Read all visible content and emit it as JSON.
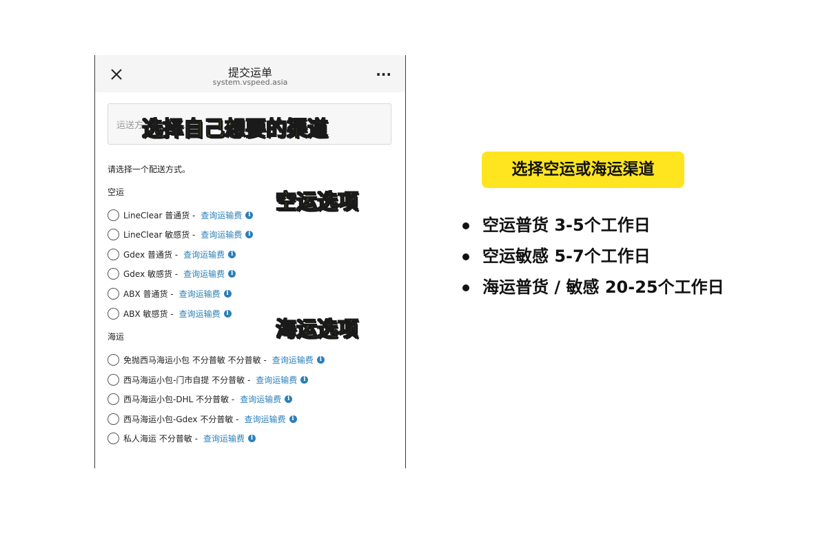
{
  "header": {
    "title": "提交运单",
    "url": "system.vspeed.asia",
    "more_label": "···"
  },
  "channel_input": {
    "placeholder": "运送方"
  },
  "overlays": {
    "main": "选择自己想要的渠道",
    "air": "空运选项",
    "sea": "海运选项"
  },
  "instruction": "请选择一个配送方式。",
  "sections": {
    "air": {
      "label": "空运",
      "options": [
        {
          "label": "LineClear 普通货 -",
          "link": "查询运输费"
        },
        {
          "label": "LineClear 敏感货 -",
          "link": "查询运输费"
        },
        {
          "label": "Gdex 普通货 -",
          "link": "查询运输费"
        },
        {
          "label": "Gdex 敏感货 -",
          "link": "查询运输费"
        },
        {
          "label": "ABX 普通货 -",
          "link": "查询运输费"
        },
        {
          "label": "ABX 敏感货 -",
          "link": "查询运输费"
        }
      ]
    },
    "sea": {
      "label": "海运",
      "options": [
        {
          "label": "免抛西马海运小包 不分普敏 不分普敏 -",
          "link": "查询运输费"
        },
        {
          "label": "西马海运小包-门市自提 不分普敏 -",
          "link": "查询运输费"
        },
        {
          "label": "西马海运小包-DHL 不分普敏 -",
          "link": "查询运输费"
        },
        {
          "label": "西马海运小包-Gdex 不分普敏 -",
          "link": "查询运输费"
        },
        {
          "label": "私人海运 不分普敏 -",
          "link": "查询运输费"
        }
      ]
    }
  },
  "info_icon_glyph": "i",
  "annotation": {
    "badge": "选择空运或海运渠道",
    "bullets": [
      "空运普货 3-5个工作日",
      "空运敏感 5-7个工作日",
      "海运普货 / 敏感 20-25个工作日"
    ]
  },
  "colors": {
    "highlight_yellow": "#ffe51f",
    "link_blue": "#2a7fb8",
    "header_bg": "#f5f5f5"
  },
  "icons": [
    "close-icon",
    "more-icon",
    "radio-icon",
    "info-icon",
    "bullet-dot-icon"
  ]
}
